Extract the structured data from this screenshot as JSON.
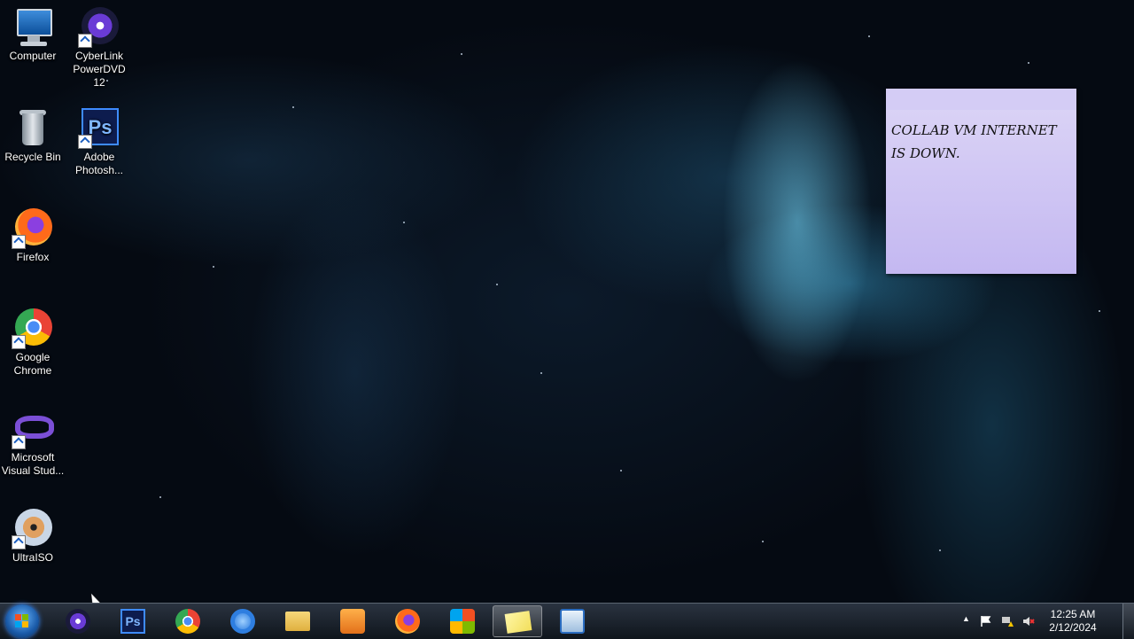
{
  "desktop_icons": [
    {
      "label": "Computer",
      "icon": "computer-icon"
    },
    {
      "label": "CyberLink PowerDVD 12",
      "icon": "powerdvd-icon"
    },
    {
      "label": "Recycle Bin",
      "icon": "recycle-bin-icon"
    },
    {
      "label": "Adobe Photosh...",
      "icon": "photoshop-icon"
    },
    {
      "label": "Firefox",
      "icon": "firefox-icon"
    },
    {
      "label": "Google Chrome",
      "icon": "chrome-icon"
    },
    {
      "label": "Microsoft Visual Stud...",
      "icon": "visual-studio-icon"
    },
    {
      "label": "UltraISO",
      "icon": "ultraiso-icon"
    }
  ],
  "sticky_note": {
    "text": "COLLAB VM INTERNET IS DOWN."
  },
  "taskbar": {
    "items": [
      "start-orb",
      "powerdvd",
      "photoshop",
      "chrome",
      "internet-explorer",
      "windows-explorer",
      "media-player",
      "firefox",
      "windows-logo-app",
      "sticky-notes",
      "remote-desktop"
    ],
    "ps_label": "Ps"
  },
  "tray": {
    "time": "12:25 AM",
    "date": "2/12/2024",
    "show_hidden": "▲"
  },
  "colors": {
    "sticky": "#d4ccf5",
    "taskbar": "#1a222c",
    "accent": "#3c8bff"
  }
}
